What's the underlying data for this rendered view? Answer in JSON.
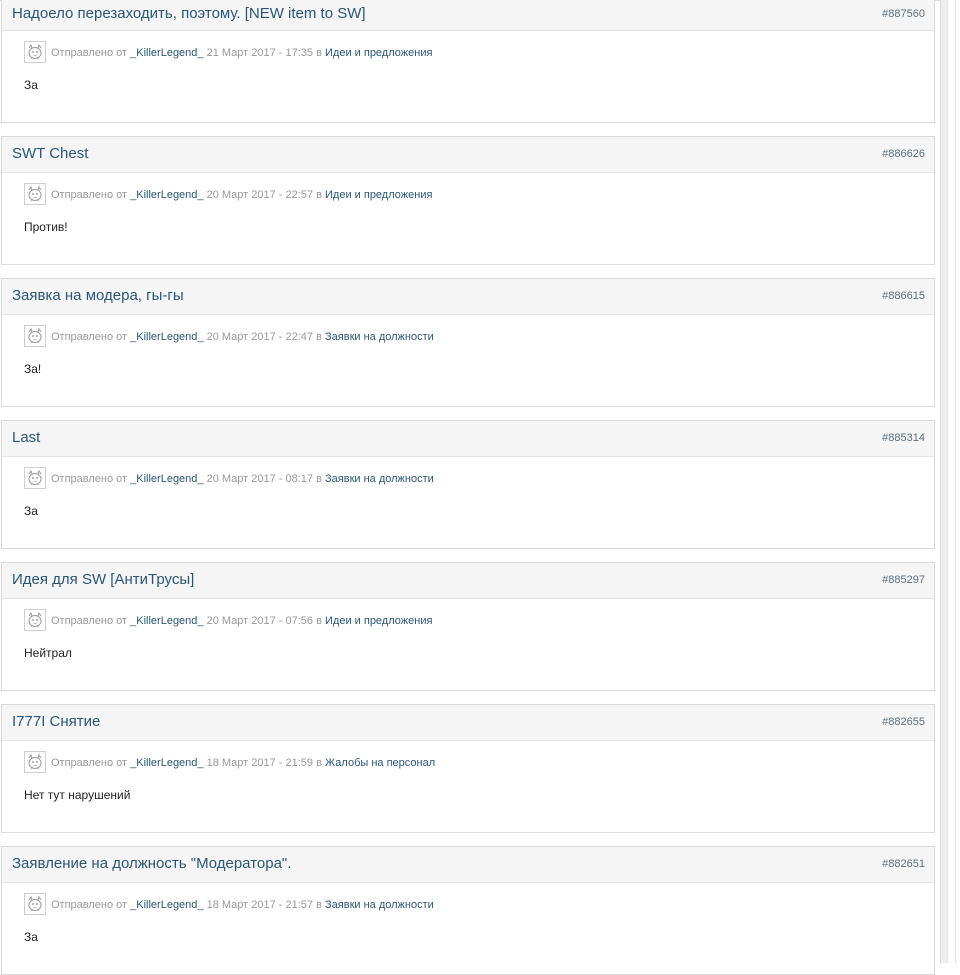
{
  "meta_labels": {
    "sent_by": "Отправлено от",
    "in": "в"
  },
  "posts": [
    {
      "title": "Надоело перезаходить, поэтому. [NEW item to SW]",
      "id": "#887560",
      "author": "_KillerLegend_",
      "date": "21 Март 2017 - 17:35",
      "forum": "Идеи и предложения",
      "text": "За"
    },
    {
      "title": "SWT Chest",
      "id": "#886626",
      "author": "_KillerLegend_",
      "date": "20 Март 2017 - 22:57",
      "forum": "Идеи и предложения",
      "text": "Против!"
    },
    {
      "title": "Заявка на модера, гы-гы",
      "id": "#886615",
      "author": "_KillerLegend_",
      "date": "20 Март 2017 - 22:47",
      "forum": "Заявки на должности",
      "text": "За!"
    },
    {
      "title": "Last",
      "id": "#885314",
      "author": "_KillerLegend_",
      "date": "20 Март 2017 - 08:17",
      "forum": "Заявки на должности",
      "text": "За"
    },
    {
      "title": "Идея для SW [АнтиТрусы]",
      "id": "#885297",
      "author": "_KillerLegend_",
      "date": "20 Март 2017 - 07:56",
      "forum": "Идеи и предложения",
      "text": "Нейтрал"
    },
    {
      "title": "I777I Снятие",
      "id": "#882655",
      "author": "_KillerLegend_",
      "date": "18 Март 2017 - 21:59",
      "forum": "Жалобы на персонал",
      "text": "Нет тут нарушений"
    },
    {
      "title": "Заявление на должность \"Модератора\".",
      "id": "#882651",
      "author": "_KillerLegend_",
      "date": "18 Март 2017 - 21:57",
      "forum": "Заявки на должности",
      "text": "За"
    }
  ]
}
